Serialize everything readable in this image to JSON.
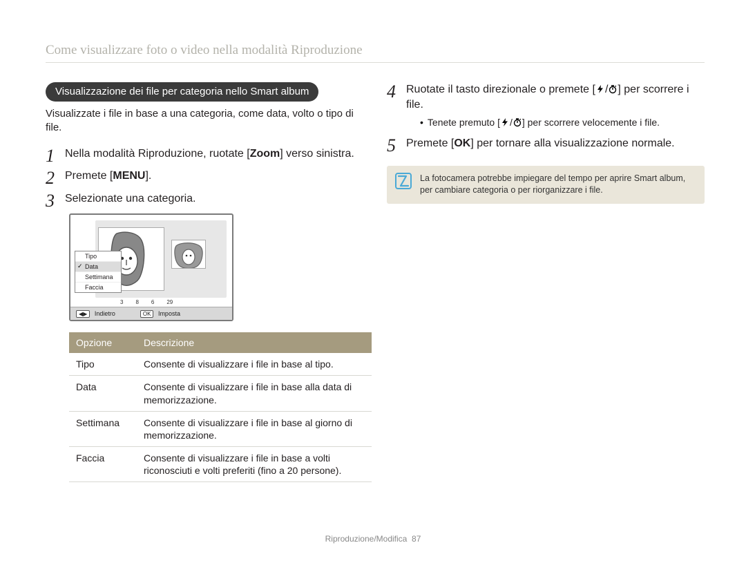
{
  "page_title": "Come visualizzare foto o video nella modalità Riproduzione",
  "pill_heading": "Visualizzazione dei file per categoria nello Smart album",
  "intro_text": "Visualizzate i file in base a una categoria, come data, volto o tipo di file.",
  "steps_left": [
    {
      "pre": "Nella modalità Riproduzione, ruotate [",
      "bold": "Zoom",
      "post": "] verso sinistra."
    },
    {
      "pre": "Premete [",
      "bold": "MENU",
      "post": "]."
    },
    {
      "pre": "Selezionate una categoria.",
      "bold": "",
      "post": ""
    }
  ],
  "screen": {
    "dropdown": [
      "Tipo",
      "Data",
      "Settimana",
      "Faccia"
    ],
    "selected_index": 1,
    "timeline_labels": [
      "3",
      "8",
      "6",
      "29"
    ],
    "footer": {
      "back_icon_label": "◀▶",
      "back_text": "Indietro",
      "set_icon_label": "OK",
      "set_text": "Imposta"
    }
  },
  "table": {
    "headers": [
      "Opzione",
      "Descrizione"
    ],
    "rows": [
      {
        "opt": "Tipo",
        "desc": "Consente di visualizzare i file in base al tipo."
      },
      {
        "opt": "Data",
        "desc": "Consente di visualizzare i file in base alla data di memorizzazione."
      },
      {
        "opt": "Settimana",
        "desc": "Consente di visualizzare i file in base al giorno di memorizzazione."
      },
      {
        "opt": "Faccia",
        "desc": "Consente di visualizzare i file in base a volti riconosciuti e volti preferiti (fino a 20 persone)."
      }
    ]
  },
  "steps_right": {
    "step4": {
      "pre": "Ruotate il tasto direzionale o premete [",
      "mid": "/",
      "post": "] per scorrere i file.",
      "sub_bullet_pre": "Tenete premuto [",
      "sub_bullet_mid": "/",
      "sub_bullet_post": "] per scorrere velocemente i file."
    },
    "step5": {
      "pre": "Premete [",
      "bold": "OK",
      "post": "] per tornare alla visualizzazione normale."
    }
  },
  "note_text": "La fotocamera potrebbe impiegare del tempo per aprire Smart album, per cambiare categoria o per riorganizzare i file.",
  "footer_text": "Riproduzione/Modifica",
  "page_number": "87"
}
